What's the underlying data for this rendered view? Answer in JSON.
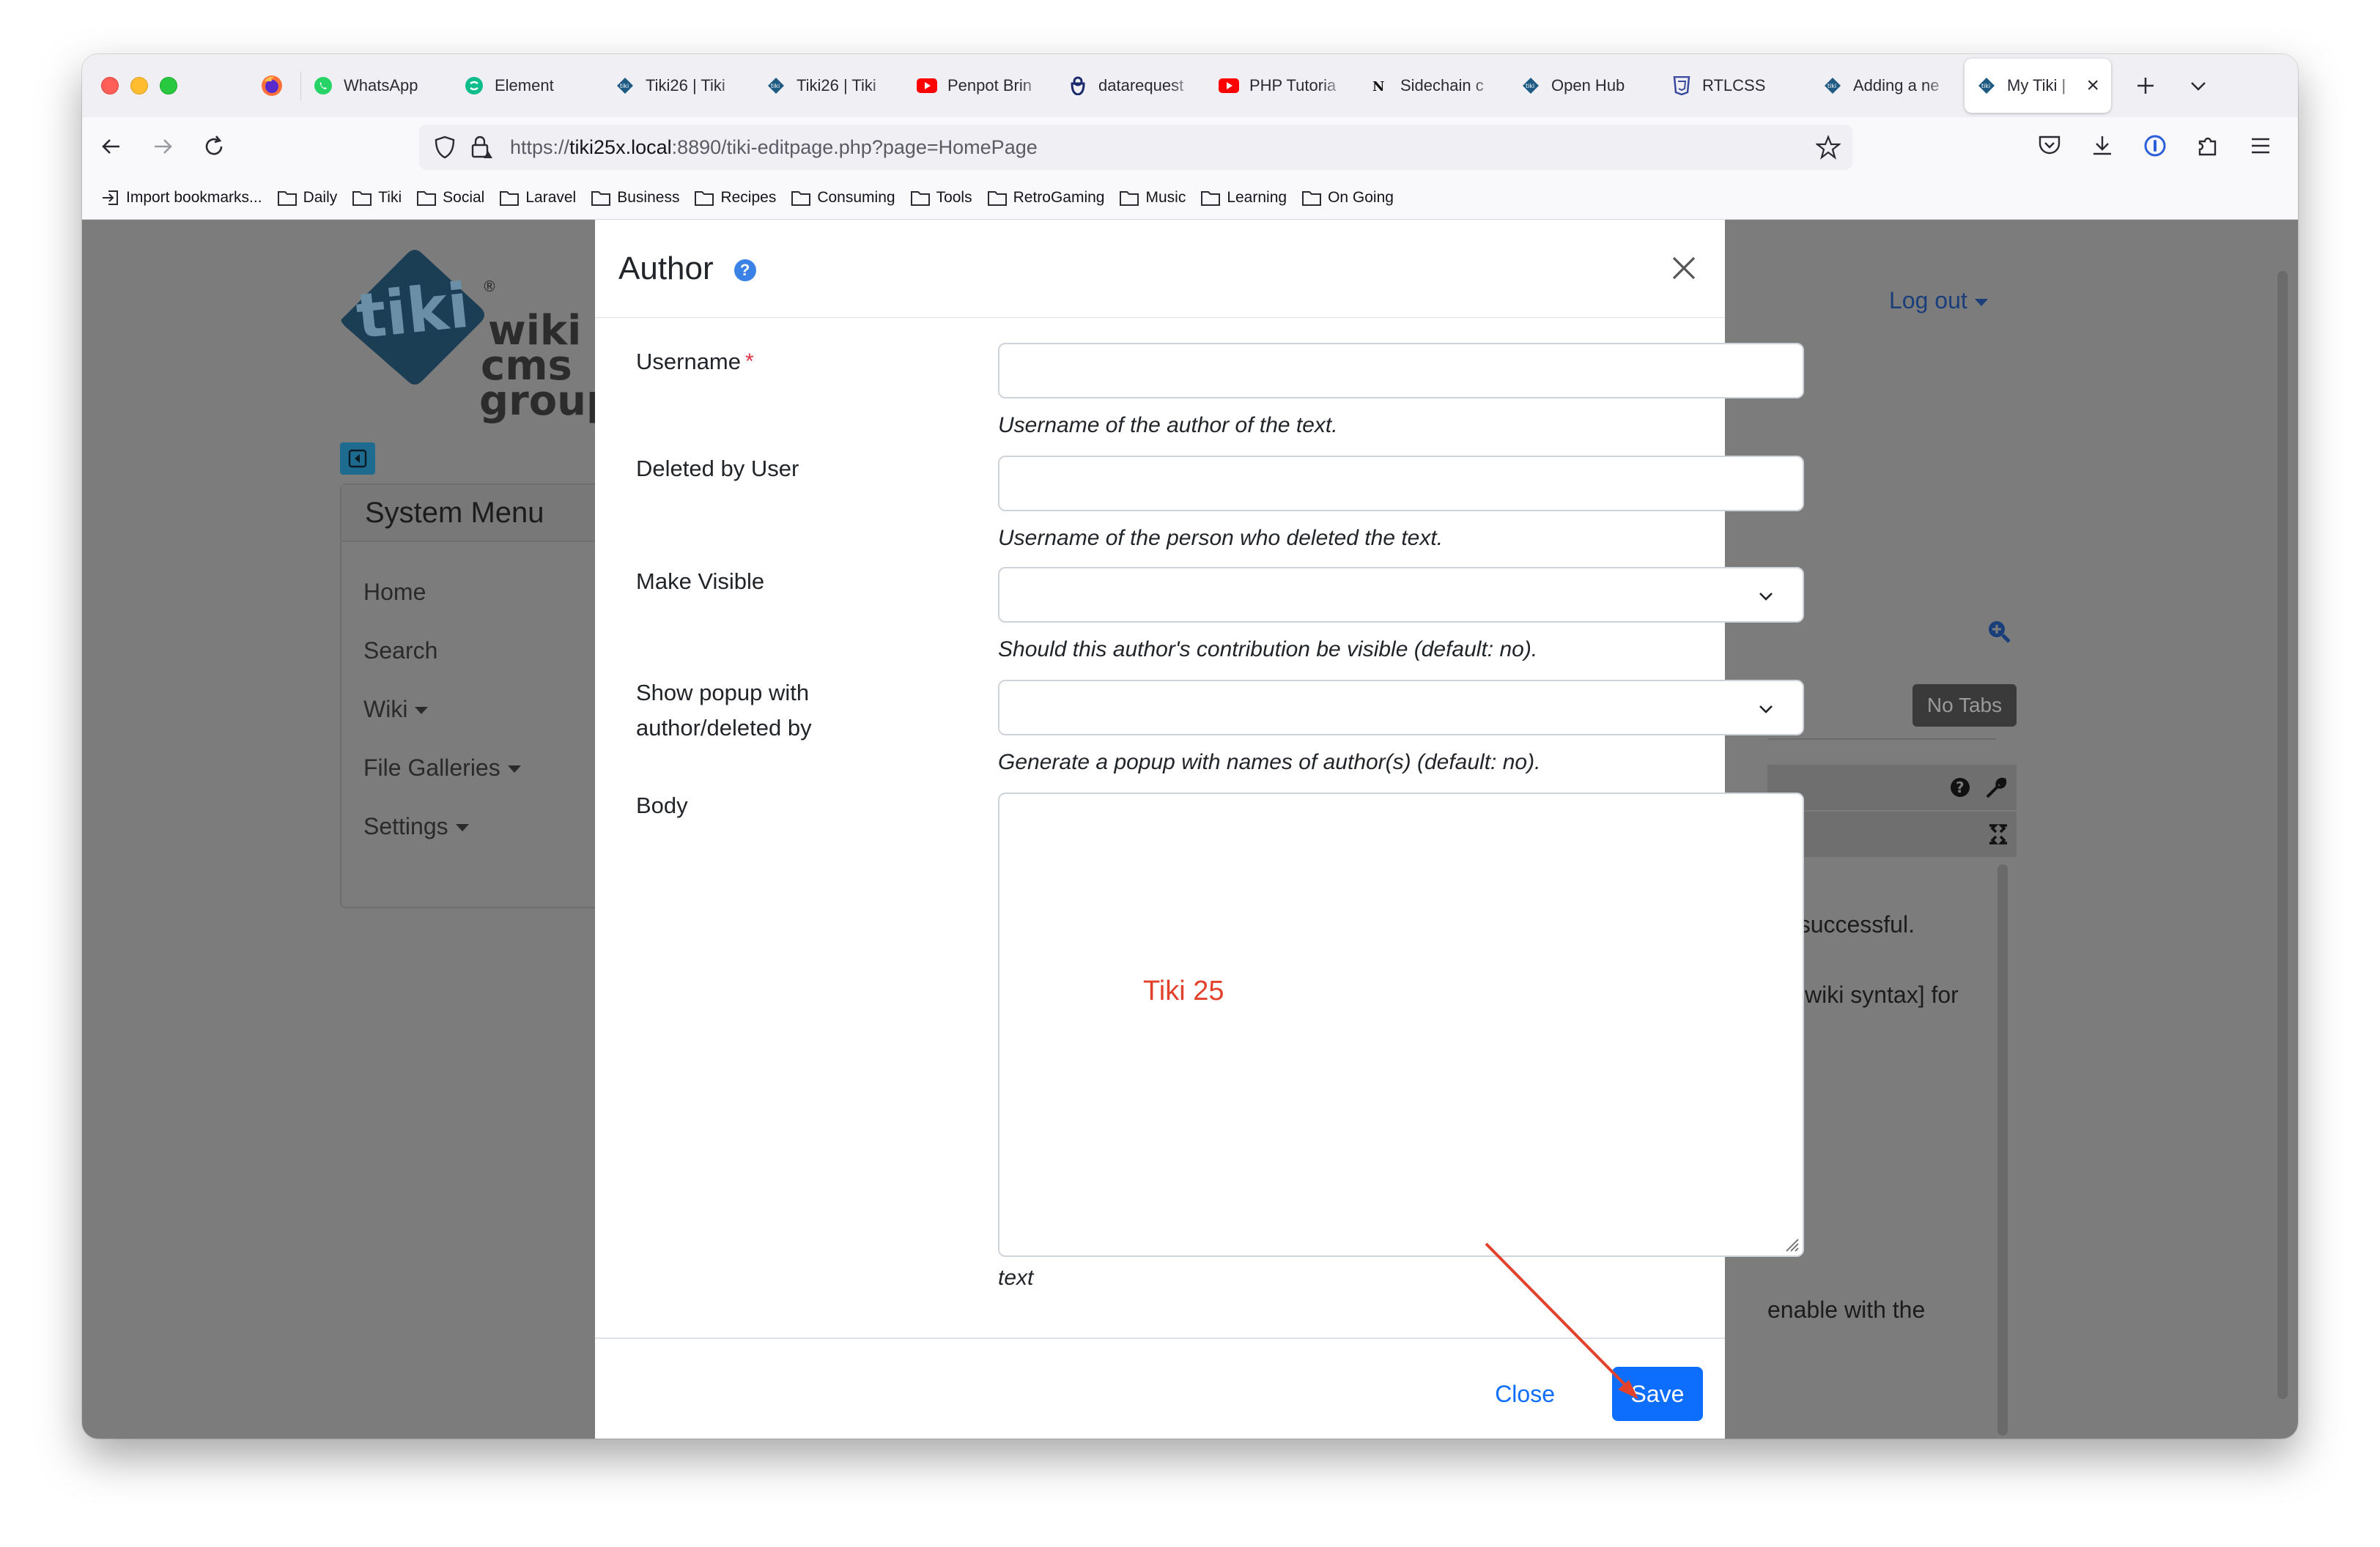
{
  "browser": {
    "tabs": [
      {
        "label": "WhatsApp",
        "icon": "whatsapp-icon"
      },
      {
        "label": "Element",
        "icon": "element-icon"
      },
      {
        "label": "Tiki26 | Tiki",
        "icon": "tiki-icon"
      },
      {
        "label": "Tiki26 | Tiki",
        "icon": "tiki-icon"
      },
      {
        "label": "Penpot Brin",
        "icon": "youtube-icon"
      },
      {
        "label": "datarequest",
        "icon": "lock-person-icon"
      },
      {
        "label": "PHP Tutoria",
        "icon": "youtube-icon"
      },
      {
        "label": "Sidechain c",
        "icon": "notion-icon"
      },
      {
        "label": "Open Hub",
        "icon": "tiki-icon"
      },
      {
        "label": "RTLCSS",
        "icon": "css3-icon"
      },
      {
        "label": "Adding a ne",
        "icon": "tiki-icon"
      },
      {
        "label": "My Tiki |",
        "icon": "tiki-icon",
        "active": true
      }
    ],
    "url_prefix": "https://",
    "url_host": "tiki25x.local",
    "url_rest": ":8890/tiki-editpage.php?page=HomePage",
    "bookmarks": [
      "Import bookmarks...",
      "Daily",
      "Tiki",
      "Social",
      "Laravel",
      "Business",
      "Recipes",
      "Consuming",
      "Tools",
      "RetroGaming",
      "Music",
      "Learning",
      "On Going"
    ]
  },
  "background_page": {
    "logo": {
      "mark": "tiki",
      "line1": "wiki",
      "line2": "cms",
      "line3": "group",
      "registered": "®"
    },
    "system_menu": {
      "title": "System Menu",
      "items": [
        "Home",
        "Search",
        "Wiki",
        "File Galleries",
        "Settings"
      ]
    },
    "logout": "Log out",
    "no_tabs": "No Tabs",
    "text_fragments": [
      "as successful.",
      "tax|wiki syntax] for",
      "enable with the"
    ]
  },
  "modal": {
    "title": "Author",
    "fields": {
      "username": {
        "label": "Username",
        "required_mark": "*",
        "value": "",
        "help": "Username of the author of the text."
      },
      "deleted_by": {
        "label": "Deleted by User",
        "value": "",
        "help": "Username of the person who deleted the text."
      },
      "make_visible": {
        "label": "Make Visible",
        "value": "",
        "help": "Should this author's contribution be visible (default: no)."
      },
      "show_popup": {
        "label_line1": "Show popup with",
        "label_line2": "author/deleted by",
        "value": "",
        "help": "Generate a popup with names of author(s) (default: no)."
      },
      "body": {
        "label": "Body",
        "value": "",
        "help": "text"
      }
    },
    "watermark": "Tiki 25",
    "buttons": {
      "close": "Close",
      "save": "Save"
    }
  },
  "colors": {
    "primary": "#0d6efd",
    "annotation_arrow": "#e2412b",
    "overlay": "#7c7c7c"
  }
}
